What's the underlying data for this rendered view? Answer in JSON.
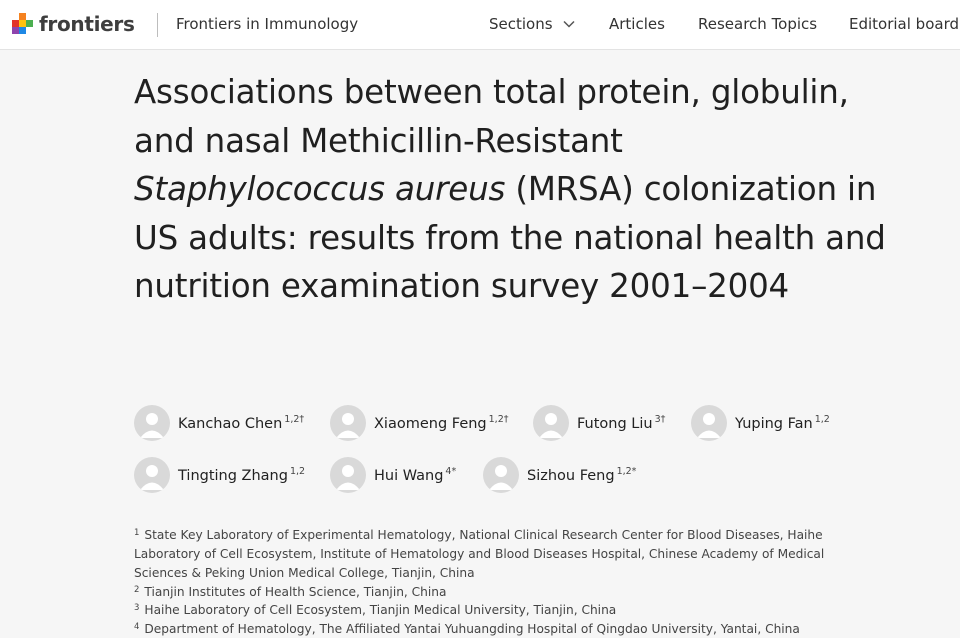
{
  "header": {
    "brand": "frontiers",
    "journal": "Frontiers in Immunology",
    "nav": {
      "sections": "Sections",
      "articles": "Articles",
      "research_topics": "Research Topics",
      "editorial_board": "Editorial board"
    }
  },
  "article": {
    "title_part1": "Associations between total protein, globulin, and nasal Methicillin-Resistant",
    "title_italic": "Staphylococcus aureus",
    "title_part2": "(MRSA) colonization in US adults: results from the national health and nutrition examination survey 2001–2004"
  },
  "authors": [
    {
      "name": "Kanchao Chen",
      "sup": "1,2†"
    },
    {
      "name": "Xiaomeng Feng",
      "sup": "1,2†"
    },
    {
      "name": "Futong Liu",
      "sup": "3†"
    },
    {
      "name": "Yuping Fan",
      "sup": "1,2"
    },
    {
      "name": "Tingting Zhang",
      "sup": "1,2"
    },
    {
      "name": "Hui Wang",
      "sup": "4*"
    },
    {
      "name": "Sizhou Feng",
      "sup": "1,2*"
    }
  ],
  "affiliations": [
    {
      "num": "1",
      "text": "State Key Laboratory of Experimental Hematology, National Clinical Research Center for Blood Diseases, Haihe Laboratory of Cell Ecosystem, Institute of Hematology and Blood Diseases Hospital, Chinese Academy of Medical Sciences & Peking Union Medical College, Tianjin, China"
    },
    {
      "num": "2",
      "text": "Tianjin Institutes of Health Science, Tianjin, China"
    },
    {
      "num": "3",
      "text": "Haihe Laboratory of Cell Ecosystem, Tianjin Medical University, Tianjin, China"
    },
    {
      "num": "4",
      "text": "Department of Hematology, The Affiliated Yantai Yuhuangding Hospital of Qingdao University, Yantai, China"
    }
  ],
  "colors": {
    "logo_red": "#e2332b",
    "logo_orange": "#f58220",
    "logo_yellow": "#ffc20e",
    "logo_green": "#4caf50",
    "logo_blue": "#1e88e5",
    "logo_purple": "#8e44ad"
  }
}
